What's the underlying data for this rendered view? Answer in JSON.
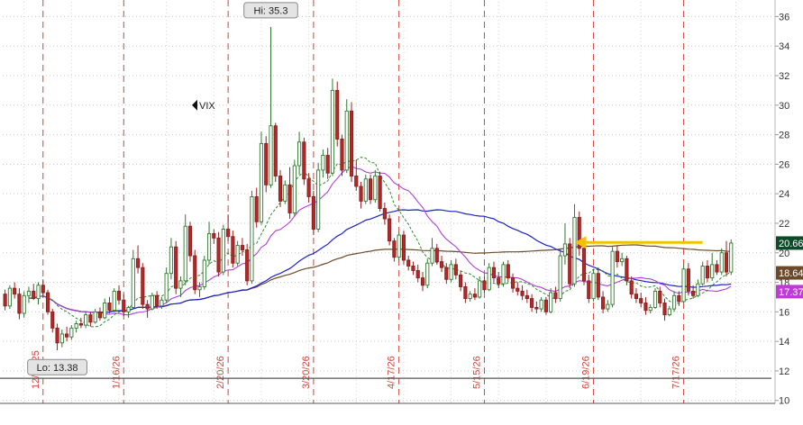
{
  "chart_data": {
    "type": "candlestick",
    "symbol": "VIX",
    "y_range": [
      9.8,
      37
    ],
    "y_ticks": [
      10,
      12,
      14,
      16,
      18,
      20,
      22,
      24,
      26,
      28,
      30,
      32,
      34,
      36
    ],
    "x_count": 162,
    "annotations": {
      "high_label": "Hi: 35.3",
      "high_value": 35.3,
      "high_index": 56,
      "low_label": "Lo: 13.38",
      "low_value": 13.38,
      "low_index": 11
    },
    "reference_line": {
      "value": 11.5
    },
    "event_markers": [
      {
        "label": "12/19/25",
        "index": 8
      },
      {
        "label": "1/16/26",
        "index": 25
      },
      {
        "label": "2/20/26",
        "index": 47
      },
      {
        "label": "3/20/26",
        "index": 65
      },
      {
        "label": "4/17/26",
        "index": 83
      },
      {
        "label": "5/15/26",
        "index": 101
      },
      {
        "label": "6/19/26",
        "index": 124
      },
      {
        "label": "7/17/26",
        "index": 143
      }
    ],
    "price_tags": [
      {
        "value": "20.66",
        "y": 20.66,
        "color": "#0c4a2a"
      },
      {
        "value": "18.64",
        "y": 18.64,
        "color": "#6b4a2b"
      },
      {
        "value": "17.37",
        "y": 17.37,
        "color": "#c03ad8"
      }
    ],
    "arrow": {
      "from_index": 147,
      "to_index": 120,
      "y": 20.7,
      "color": "#f2c200"
    },
    "candles": [
      [
        17.2,
        17.5,
        16.1,
        16.4
      ],
      [
        16.4,
        17.8,
        16.2,
        17.6
      ],
      [
        17.6,
        18.0,
        16.9,
        17.2
      ],
      [
        17.2,
        17.6,
        15.5,
        15.9
      ],
      [
        15.9,
        17.4,
        15.6,
        17.1
      ],
      [
        17.1,
        17.7,
        16.6,
        17.4
      ],
      [
        17.4,
        17.9,
        16.8,
        16.9
      ],
      [
        16.9,
        18.0,
        16.5,
        17.8
      ],
      [
        17.8,
        18.2,
        17.0,
        17.3
      ],
      [
        17.3,
        17.5,
        15.8,
        16.0
      ],
      [
        16.0,
        16.2,
        14.6,
        14.9
      ],
      [
        14.9,
        15.2,
        13.4,
        13.9
      ],
      [
        13.9,
        14.8,
        13.6,
        14.5
      ],
      [
        14.5,
        15.0,
        14.0,
        14.3
      ],
      [
        14.3,
        15.1,
        14.1,
        14.9
      ],
      [
        14.9,
        15.4,
        14.6,
        15.2
      ],
      [
        15.2,
        15.6,
        14.9,
        15.1
      ],
      [
        15.1,
        16.0,
        14.9,
        15.8
      ],
      [
        15.8,
        16.0,
        15.0,
        15.3
      ],
      [
        15.3,
        16.2,
        15.2,
        16.0
      ],
      [
        16.0,
        16.3,
        15.4,
        15.6
      ],
      [
        15.6,
        16.9,
        15.5,
        16.6
      ],
      [
        16.6,
        17.0,
        15.9,
        16.1
      ],
      [
        16.1,
        17.6,
        16.0,
        17.4
      ],
      [
        17.4,
        17.8,
        16.5,
        16.8
      ],
      [
        16.8,
        17.2,
        15.7,
        16.0
      ],
      [
        16.0,
        16.4,
        15.6,
        16.3
      ],
      [
        16.3,
        20.2,
        16.2,
        19.6
      ],
      [
        19.6,
        20.5,
        18.6,
        19.0
      ],
      [
        19.0,
        19.3,
        16.2,
        16.5
      ],
      [
        16.5,
        16.8,
        15.6,
        16.2
      ],
      [
        16.2,
        17.3,
        16.1,
        17.1
      ],
      [
        17.1,
        17.4,
        16.2,
        16.4
      ],
      [
        16.4,
        17.0,
        16.2,
        16.8
      ],
      [
        16.8,
        19.0,
        16.6,
        18.6
      ],
      [
        18.6,
        21.0,
        18.2,
        20.4
      ],
      [
        20.4,
        20.8,
        17.2,
        17.6
      ],
      [
        17.6,
        18.4,
        17.0,
        18.1
      ],
      [
        18.1,
        22.6,
        17.8,
        21.8
      ],
      [
        21.8,
        22.1,
        19.4,
        19.8
      ],
      [
        19.8,
        20.2,
        17.2,
        17.5
      ],
      [
        17.5,
        18.0,
        17.0,
        17.7
      ],
      [
        17.7,
        19.8,
        17.5,
        19.5
      ],
      [
        19.5,
        22.1,
        19.2,
        21.3
      ],
      [
        21.3,
        21.6,
        20.6,
        21.0
      ],
      [
        21.0,
        21.4,
        18.4,
        18.7
      ],
      [
        18.7,
        21.9,
        18.5,
        21.6
      ],
      [
        21.6,
        22.6,
        20.8,
        21.1
      ],
      [
        21.1,
        21.5,
        19.0,
        19.3
      ],
      [
        19.3,
        20.8,
        19.1,
        20.5
      ],
      [
        20.5,
        21.0,
        19.8,
        20.2
      ],
      [
        20.2,
        20.6,
        17.8,
        18.1
      ],
      [
        18.1,
        24.2,
        17.9,
        23.8
      ],
      [
        23.8,
        24.4,
        21.7,
        22.1
      ],
      [
        22.1,
        28.2,
        21.9,
        27.4
      ],
      [
        27.4,
        27.9,
        24.1,
        24.6
      ],
      [
        24.6,
        35.3,
        24.4,
        28.6
      ],
      [
        28.6,
        28.8,
        24.8,
        25.2
      ],
      [
        25.2,
        25.6,
        23.1,
        23.5
      ],
      [
        23.5,
        24.9,
        23.3,
        24.6
      ],
      [
        24.6,
        25.8,
        22.3,
        22.7
      ],
      [
        22.7,
        26.3,
        22.5,
        25.9
      ],
      [
        25.9,
        28.2,
        25.3,
        27.5
      ],
      [
        27.5,
        27.8,
        24.6,
        25.0
      ],
      [
        25.0,
        25.4,
        23.4,
        23.8
      ],
      [
        23.8,
        24.2,
        21.2,
        21.6
      ],
      [
        21.6,
        26.1,
        21.4,
        25.6
      ],
      [
        25.6,
        27.0,
        25.1,
        26.6
      ],
      [
        26.6,
        27.1,
        25.0,
        25.4
      ],
      [
        25.4,
        31.8,
        25.2,
        31.0
      ],
      [
        31.0,
        31.6,
        27.2,
        27.7
      ],
      [
        27.7,
        28.0,
        25.2,
        25.6
      ],
      [
        25.6,
        30.4,
        25.4,
        29.6
      ],
      [
        29.6,
        30.2,
        24.8,
        25.2
      ],
      [
        25.2,
        26.3,
        24.2,
        24.5
      ],
      [
        24.5,
        24.8,
        23.0,
        23.5
      ],
      [
        23.5,
        25.3,
        23.3,
        25.0
      ],
      [
        25.0,
        25.3,
        23.3,
        23.6
      ],
      [
        23.6,
        25.6,
        23.4,
        25.2
      ],
      [
        25.2,
        25.5,
        22.8,
        23.0
      ],
      [
        23.0,
        23.4,
        21.9,
        22.3
      ],
      [
        22.3,
        22.6,
        20.5,
        20.8
      ],
      [
        20.8,
        21.0,
        19.4,
        19.7
      ],
      [
        19.7,
        21.4,
        19.5,
        21.2
      ],
      [
        21.2,
        21.5,
        19.2,
        19.5
      ],
      [
        19.5,
        19.8,
        18.8,
        19.1
      ],
      [
        19.1,
        19.4,
        18.5,
        18.8
      ],
      [
        18.8,
        19.2,
        18.0,
        18.3
      ],
      [
        18.3,
        18.7,
        17.4,
        17.8
      ],
      [
        17.8,
        19.6,
        17.6,
        19.3
      ],
      [
        19.3,
        21.0,
        19.1,
        20.3
      ],
      [
        20.3,
        20.6,
        19.2,
        19.4
      ],
      [
        19.4,
        19.8,
        18.7,
        19.0
      ],
      [
        19.0,
        19.3,
        17.9,
        18.2
      ],
      [
        18.2,
        19.5,
        18.0,
        19.2
      ],
      [
        19.2,
        19.6,
        18.2,
        18.5
      ],
      [
        18.5,
        18.8,
        17.4,
        17.7
      ],
      [
        17.7,
        18.0,
        16.6,
        16.9
      ],
      [
        16.9,
        17.4,
        16.7,
        17.2
      ],
      [
        17.2,
        17.6,
        16.8,
        17.0
      ],
      [
        17.0,
        18.4,
        16.9,
        18.1
      ],
      [
        18.1,
        18.4,
        17.3,
        17.5
      ],
      [
        17.5,
        19.3,
        17.4,
        19.0
      ],
      [
        19.0,
        19.4,
        18.0,
        18.3
      ],
      [
        18.3,
        18.7,
        17.6,
        17.9
      ],
      [
        17.9,
        19.4,
        17.7,
        19.2
      ],
      [
        19.2,
        19.5,
        18.0,
        18.3
      ],
      [
        18.3,
        18.6,
        17.3,
        17.6
      ],
      [
        17.6,
        18.0,
        17.1,
        17.4
      ],
      [
        17.4,
        17.8,
        16.8,
        17.1
      ],
      [
        17.1,
        17.5,
        16.6,
        16.9
      ],
      [
        16.9,
        17.2,
        16.0,
        16.3
      ],
      [
        16.3,
        16.7,
        15.9,
        16.2
      ],
      [
        16.2,
        17.0,
        16.0,
        16.8
      ],
      [
        16.8,
        17.0,
        15.8,
        16.0
      ],
      [
        16.0,
        17.6,
        15.9,
        17.3
      ],
      [
        17.3,
        17.7,
        16.6,
        16.9
      ],
      [
        16.9,
        20.3,
        16.7,
        19.8
      ],
      [
        19.8,
        22.0,
        19.2,
        20.6
      ],
      [
        20.6,
        21.0,
        17.6,
        17.9
      ],
      [
        17.9,
        23.3,
        17.7,
        22.4
      ],
      [
        22.4,
        22.8,
        19.8,
        20.3
      ],
      [
        20.3,
        20.6,
        17.8,
        18.1
      ],
      [
        18.1,
        18.5,
        16.6,
        16.9
      ],
      [
        16.9,
        18.9,
        16.7,
        18.6
      ],
      [
        18.6,
        19.0,
        16.8,
        17.0
      ],
      [
        17.0,
        17.4,
        15.9,
        16.2
      ],
      [
        16.2,
        16.8,
        16.0,
        16.5
      ],
      [
        16.5,
        20.4,
        16.3,
        20.1
      ],
      [
        20.1,
        20.5,
        19.0,
        19.4
      ],
      [
        19.4,
        20.0,
        19.1,
        19.6
      ],
      [
        19.6,
        19.8,
        17.8,
        18.1
      ],
      [
        18.1,
        18.4,
        16.9,
        17.2
      ],
      [
        17.2,
        17.6,
        16.6,
        16.9
      ],
      [
        16.9,
        17.3,
        16.3,
        16.6
      ],
      [
        16.6,
        17.0,
        15.8,
        16.1
      ],
      [
        16.1,
        16.5,
        15.9,
        16.3
      ],
      [
        16.3,
        17.6,
        16.2,
        17.4
      ],
      [
        17.4,
        17.7,
        16.3,
        16.6
      ],
      [
        16.6,
        16.9,
        15.4,
        15.8
      ],
      [
        15.8,
        16.4,
        15.7,
        16.2
      ],
      [
        16.2,
        17.4,
        16.0,
        17.1
      ],
      [
        17.1,
        17.4,
        16.4,
        16.7
      ],
      [
        16.7,
        19.2,
        16.6,
        18.9
      ],
      [
        18.9,
        19.3,
        17.1,
        17.4
      ],
      [
        17.4,
        17.8,
        16.9,
        17.1
      ],
      [
        17.1,
        18.2,
        17.0,
        17.9
      ],
      [
        17.9,
        19.4,
        17.8,
        19.1
      ],
      [
        19.1,
        19.5,
        18.0,
        18.3
      ],
      [
        18.3,
        20.0,
        18.1,
        19.2
      ],
      [
        19.2,
        19.5,
        18.5,
        18.7
      ],
      [
        18.7,
        20.3,
        18.5,
        20.0
      ],
      [
        20.0,
        20.8,
        18.4,
        18.7
      ],
      [
        18.7,
        20.9,
        18.5,
        20.66
      ]
    ]
  }
}
